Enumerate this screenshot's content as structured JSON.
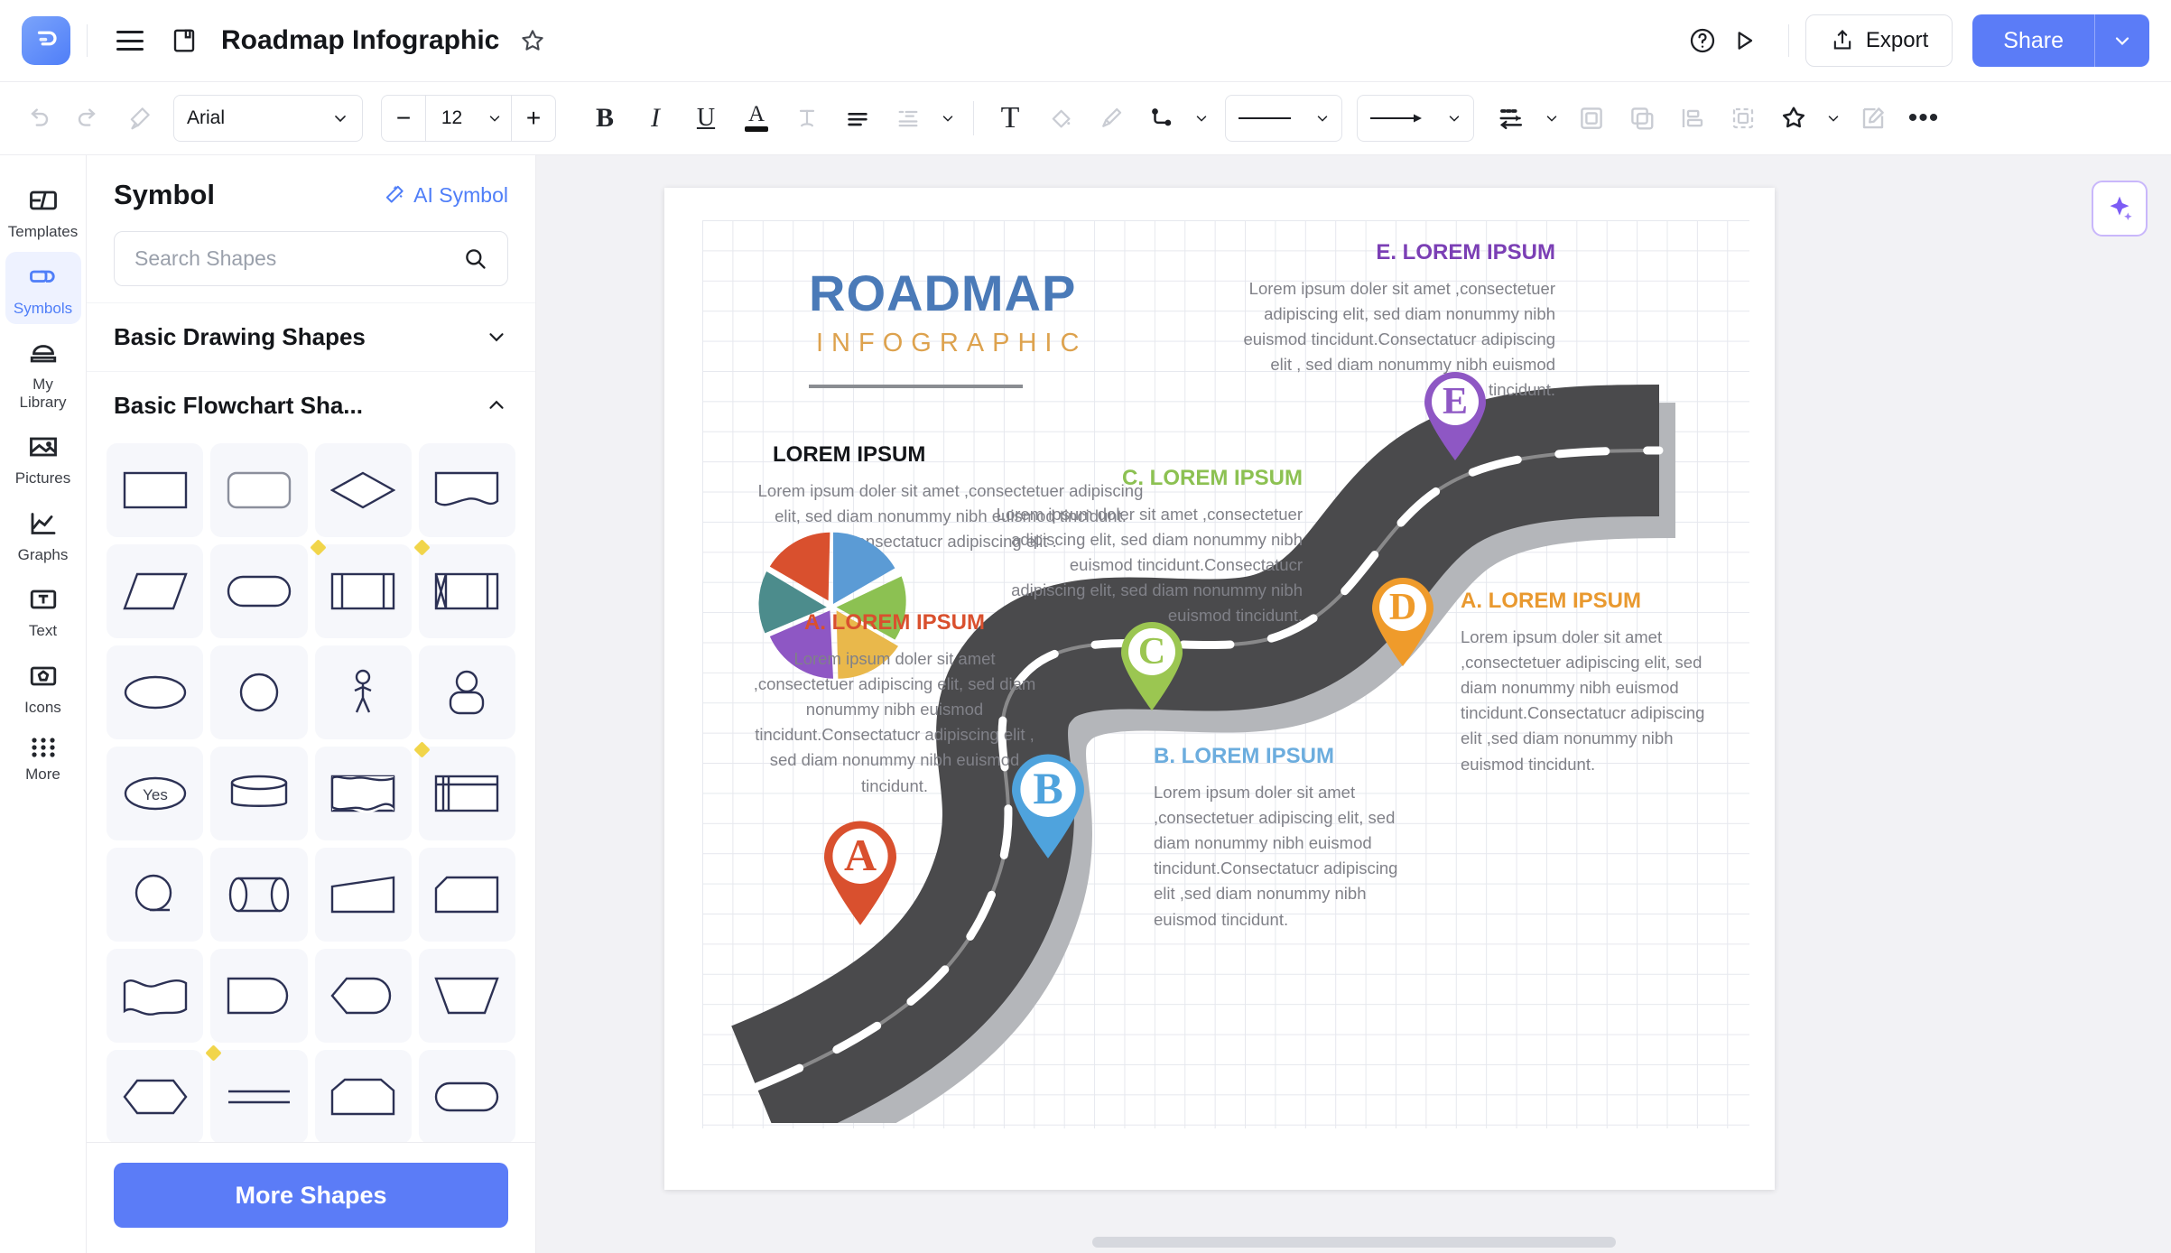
{
  "app": {
    "logo_glyph": "Ә",
    "document_title": "Roadmap Infographic",
    "menu_icon": "hamburger-icon",
    "save_icon": "save-icon",
    "favorite_icon": "star-icon",
    "help_icon": "help-circle-icon",
    "present_icon": "play-icon",
    "export_label": "Export",
    "share_label": "Share",
    "accent_blue": "#5b7cf7"
  },
  "toolbar": {
    "undo": "undo-icon",
    "redo": "redo-icon",
    "format_painter": "format-painter-icon",
    "font_family": "Arial",
    "font_size": "12",
    "minus": "−",
    "plus": "+",
    "bold": "B",
    "italic": "I",
    "underline": "U",
    "font_color": "A",
    "strikethrough_label": "T",
    "align_label": "align-icon",
    "line_spacing_label": "line-spacing-icon",
    "text_box": "T",
    "fill_color": "fill-bucket-icon",
    "line_style_brush": "brush-icon",
    "connector": "connector-icon",
    "line_weight": "line-style-preview",
    "arrow_style": "arrow-style-preview",
    "arrange": "arrange-icon",
    "front": "bring-to-front-icon",
    "back": "send-to-back-icon",
    "align_objects": "align-objects-icon",
    "group": "group-icon",
    "effects": "effects-icon",
    "edit": "edit-icon",
    "more": "•••"
  },
  "rail": {
    "items": [
      {
        "label": "Templates",
        "icon": "templates-icon",
        "active": false
      },
      {
        "label": "Symbols",
        "icon": "symbols-icon",
        "active": true
      },
      {
        "label": "My\nLibrary",
        "icon": "library-icon",
        "active": false
      },
      {
        "label": "Pictures",
        "icon": "pictures-icon",
        "active": false
      },
      {
        "label": "Graphs",
        "icon": "graphs-icon",
        "active": false
      },
      {
        "label": "Text",
        "icon": "text-icon",
        "active": false
      },
      {
        "label": "Icons",
        "icon": "icons-icon",
        "active": false
      },
      {
        "label": "More",
        "icon": "more-grid-icon",
        "active": false
      }
    ]
  },
  "panel": {
    "title": "Symbol",
    "ai_symbol": "AI Symbol",
    "search_placeholder": "Search Shapes",
    "search_value": "",
    "categories": [
      {
        "label": "Basic Drawing Shapes",
        "expanded": false
      },
      {
        "label": "Basic Flowchart Sha...",
        "expanded": true
      }
    ],
    "shapes": [
      {
        "name": "rectangle",
        "badge": false
      },
      {
        "name": "rounded-rectangle",
        "badge": false
      },
      {
        "name": "diamond",
        "badge": false
      },
      {
        "name": "document",
        "badge": false
      },
      {
        "name": "parallelogram",
        "badge": false
      },
      {
        "name": "stadium",
        "badge": false
      },
      {
        "name": "predefined-process",
        "badge": true
      },
      {
        "name": "internal-storage",
        "badge": true
      },
      {
        "name": "ellipse",
        "badge": false
      },
      {
        "name": "circle",
        "badge": false
      },
      {
        "name": "actor",
        "badge": false
      },
      {
        "name": "user",
        "badge": false
      },
      {
        "name": "decision-yes",
        "badge": false,
        "text": "Yes"
      },
      {
        "name": "database",
        "badge": false
      },
      {
        "name": "card",
        "badge": false
      },
      {
        "name": "table-shape",
        "badge": true
      },
      {
        "name": "circle-plain",
        "badge": false
      },
      {
        "name": "direct-access-storage",
        "badge": false
      },
      {
        "name": "ramp",
        "badge": false
      },
      {
        "name": "cut-corner-rectangle",
        "badge": false
      },
      {
        "name": "wave",
        "badge": false
      },
      {
        "name": "delay",
        "badge": false
      },
      {
        "name": "hexagon-round",
        "badge": false
      },
      {
        "name": "trapezoid",
        "badge": false
      },
      {
        "name": "hexagon",
        "badge": false
      },
      {
        "name": "double-line",
        "badge": true
      },
      {
        "name": "pentagon-flag",
        "badge": false
      },
      {
        "name": "pill",
        "badge": false
      }
    ],
    "more_shapes_label": "More Shapes"
  },
  "canvas": {
    "ai_button": "ai-sparkle-icon",
    "infographic": {
      "title": "ROADMAP",
      "subtitle": "INFOGRAPHIC",
      "title_color": "#4a7ab8",
      "subtitle_color": "#dda24e",
      "intro": {
        "heading": "LOREM IPSUM",
        "body": "Lorem ipsum doler sit amet ,consectetuer adipiscing elit, sed diam nonummy nibh euismod tincidunt. Consectatucr adipiscing elit ."
      },
      "sections": [
        {
          "id": "E",
          "heading": "E. LOREM IPSUM",
          "color": "#7b3fb5",
          "body": "Lorem ipsum doler sit amet ,consectetuer adipiscing elit, sed diam nonummy nibh euismod tincidunt.Consectatucr adipiscing elit , sed diam nonummy nibh euismod tincidunt."
        },
        {
          "id": "C",
          "heading": "C. LOREM IPSUM",
          "color": "#8cc152",
          "body": "Lorem ipsum doler sit amet ,consectetuer adipiscing elit, sed diam nonummy nibh euismod tincidunt.Consectatucr adipiscing elit, sed diam nonummy nibh euismod tincidunt."
        },
        {
          "id": "A-right",
          "heading": "A. LOREM IPSUM",
          "color": "#e9992f",
          "body": "Lorem ipsum doler sit amet ,consectetuer adipiscing elit, sed diam nonummy nibh euismod tincidunt.Consectatucr adipiscing elit ,sed diam nonummy nibh euismod tincidunt."
        },
        {
          "id": "A-left",
          "heading": "A. LOREM IPSUM",
          "color": "#d9502e",
          "body": "Lorem ipsum doler sit amet ,consectetuer adipiscing elit, sed diam nonummy nibh euismod tincidunt.Consectatucr adipiscing elit , sed diam nonummy nibh euismod tincidunt."
        },
        {
          "id": "B",
          "heading": "B. LOREM IPSUM",
          "color": "#6cadde",
          "body": "Lorem ipsum doler sit amet ,consectetuer adipiscing elit, sed diam nonummy nibh euismod tincidunt.Consectatucr adipiscing elit ,sed diam nonummy nibh euismod tincidunt."
        }
      ],
      "pins": [
        {
          "letter": "E",
          "color": "#8e57c4"
        },
        {
          "letter": "D",
          "color": "#ef9b2b"
        },
        {
          "letter": "C",
          "color": "#9bc651"
        },
        {
          "letter": "B",
          "color": "#4fa3dd"
        },
        {
          "letter": "A",
          "color": "#d9502e"
        }
      ],
      "pie_colors": [
        "#5b9bd5",
        "#8cc152",
        "#e9b84b",
        "#8e57c4",
        "#4c8c8c",
        "#d9502e"
      ]
    }
  }
}
